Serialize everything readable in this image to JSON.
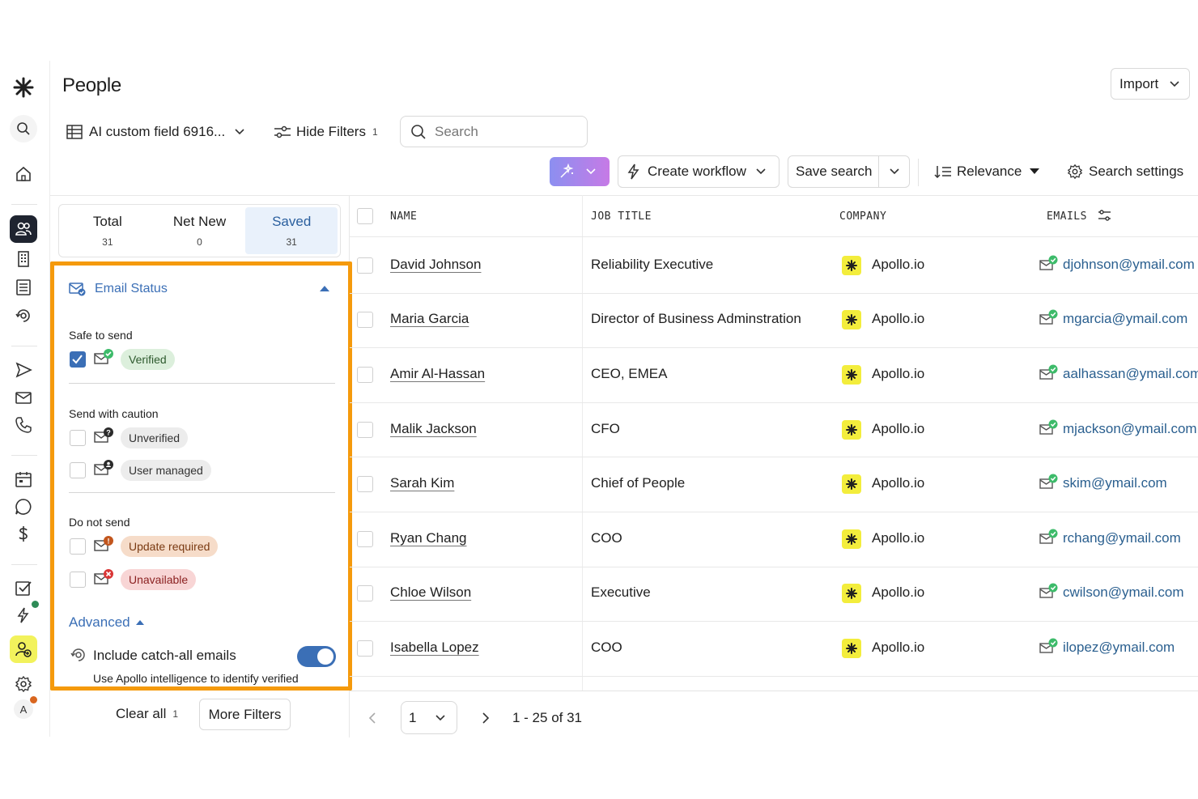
{
  "page": {
    "title": "People"
  },
  "header": {
    "import_label": "Import",
    "view_label": "AI custom field 6916...",
    "hide_filters_label": "Hide Filters",
    "hide_filters_count": "1",
    "search_placeholder": "Search",
    "create_workflow_label": "Create workflow",
    "save_search_label": "Save search",
    "relevance_label": "Relevance",
    "search_settings_label": "Search settings"
  },
  "tabs": [
    {
      "label": "Total",
      "count": "31"
    },
    {
      "label": "Net New",
      "count": "0"
    },
    {
      "label": "Saved",
      "count": "31"
    }
  ],
  "filter": {
    "title": "Email Status",
    "safe_label": "Safe to send",
    "verified": "Verified",
    "caution_label": "Send with caution",
    "unverified": "Unverified",
    "user_managed": "User managed",
    "donot_label": "Do not send",
    "update_required": "Update required",
    "unavailable": "Unavailable",
    "advanced": "Advanced",
    "catchall_label": "Include catch-all emails",
    "catchall_desc": "Use Apollo intelligence to identify verified"
  },
  "footer": {
    "clear_all": "Clear all",
    "clear_count": "1",
    "more_filters": "More Filters",
    "page_value": "1",
    "range": "1 - 25 of 31"
  },
  "table": {
    "columns": [
      "NAME",
      "JOB TITLE",
      "COMPANY",
      "EMAILS"
    ],
    "rows": [
      {
        "name": "David Johnson",
        "title": "Reliability Executive",
        "company": "Apollo.io",
        "email": "djohnson@ymail.com"
      },
      {
        "name": "Maria Garcia",
        "title": "Director of Business Adminstration",
        "company": "Apollo.io",
        "email": "mgarcia@ymail.com"
      },
      {
        "name": "Amir Al-Hassan",
        "title": "CEO, EMEA",
        "company": "Apollo.io",
        "email": "aalhassan@ymail.com"
      },
      {
        "name": "Malik Jackson",
        "title": "CFO",
        "company": "Apollo.io",
        "email": "mjackson@ymail.com"
      },
      {
        "name": "Sarah Kim",
        "title": "Chief of People",
        "company": "Apollo.io",
        "email": "skim@ymail.com"
      },
      {
        "name": "Ryan Chang",
        "title": "COO",
        "company": "Apollo.io",
        "email": "rchang@ymail.com"
      },
      {
        "name": "Chloe Wilson",
        "title": "Executive",
        "company": "Apollo.io",
        "email": "cwilson@ymail.com"
      },
      {
        "name": "Isabella Lopez",
        "title": "COO",
        "company": "Apollo.io",
        "email": "ilopez@ymail.com"
      }
    ]
  },
  "user": {
    "avatar_initial": "A"
  },
  "colors": {
    "accent": "#3b6fb6",
    "highlight": "#f59a0c",
    "brand_yellow": "#f3ed3c",
    "link": "#2a5f8f"
  }
}
